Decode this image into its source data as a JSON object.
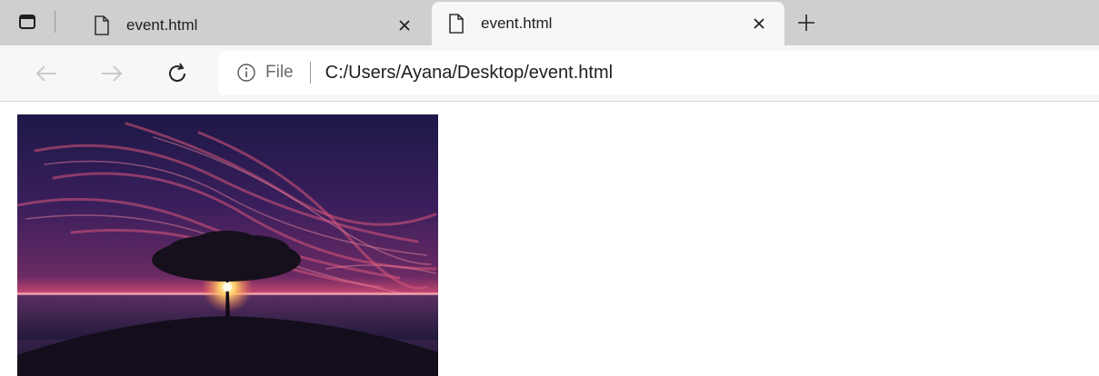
{
  "tabs": [
    {
      "title": "event.html",
      "icon": "page-icon",
      "active": false
    },
    {
      "title": "event.html",
      "icon": "page-icon",
      "active": true
    }
  ],
  "tab_actions": {
    "icon": "tab-actions-icon"
  },
  "new_tab": {
    "icon": "plus-icon"
  },
  "toolbar": {
    "back_icon": "back-arrow-icon",
    "forward_icon": "forward-arrow-icon",
    "refresh_icon": "refresh-icon"
  },
  "address": {
    "info_icon": "info-icon",
    "scheme_label": "File",
    "url": "C:/Users/Ayana/Desktop/event.html"
  },
  "page": {
    "image_subject": "sunset-tree-photo"
  },
  "colors": {
    "tabstrip_bg": "#cfcfcf",
    "toolbar_bg": "#f7f7f7",
    "sky_top": "#1d1847",
    "sky_glow": "#d94d73"
  }
}
